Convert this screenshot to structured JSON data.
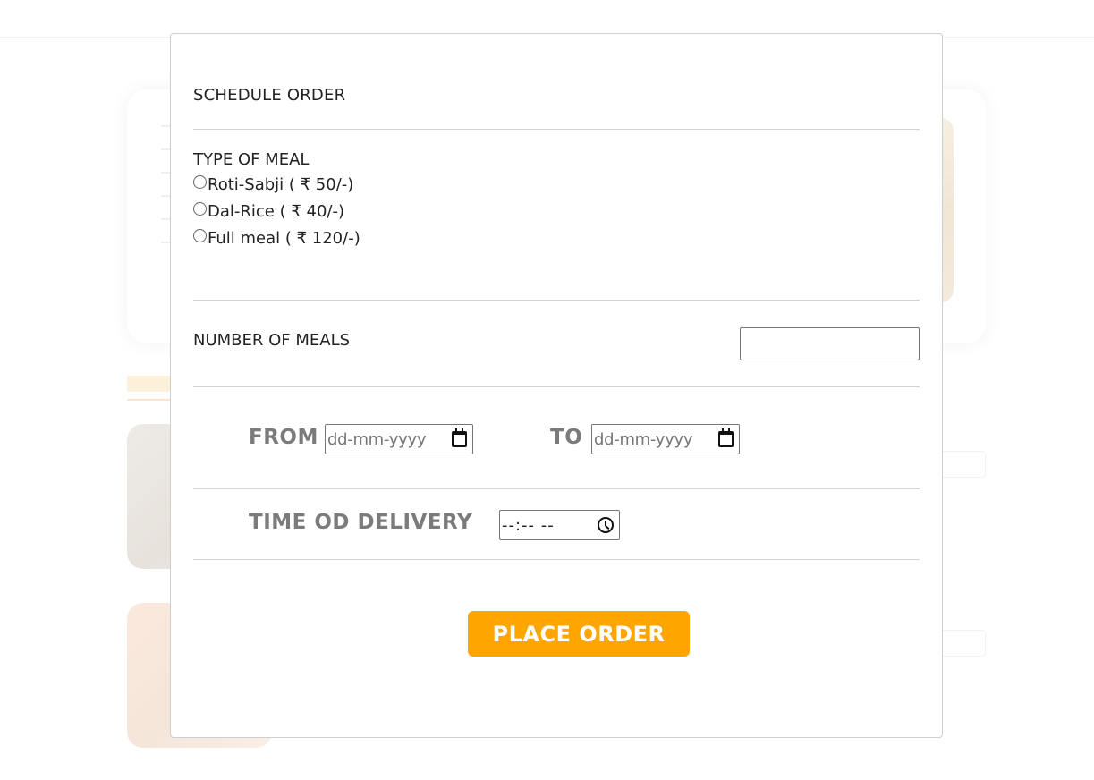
{
  "modal": {
    "title": "SCHEDULE ORDER",
    "meal_type": {
      "label": "TYPE OF MEAL",
      "options": [
        {
          "label": "Roti-Sabji ( ₹ 50/-)"
        },
        {
          "label": "Dal-Rice ( ₹ 40/-)"
        },
        {
          "label": "Full meal ( ₹ 120/-)"
        }
      ]
    },
    "number_of_meals": {
      "label": "NUMBER OF MEALS",
      "value": ""
    },
    "from": {
      "label": "FROM",
      "placeholder": "dd-mm-yyyy"
    },
    "to": {
      "label": "TO",
      "placeholder": "dd-mm-yyyy"
    },
    "delivery_time": {
      "label": "TIME OD DELIVERY",
      "placeholder": "--:-- --"
    },
    "submit_label": "PLACE ORDER"
  },
  "colors": {
    "accent": "#ffa500",
    "label_gray": "#7b7b7b",
    "divider": "#d4d4d4"
  }
}
